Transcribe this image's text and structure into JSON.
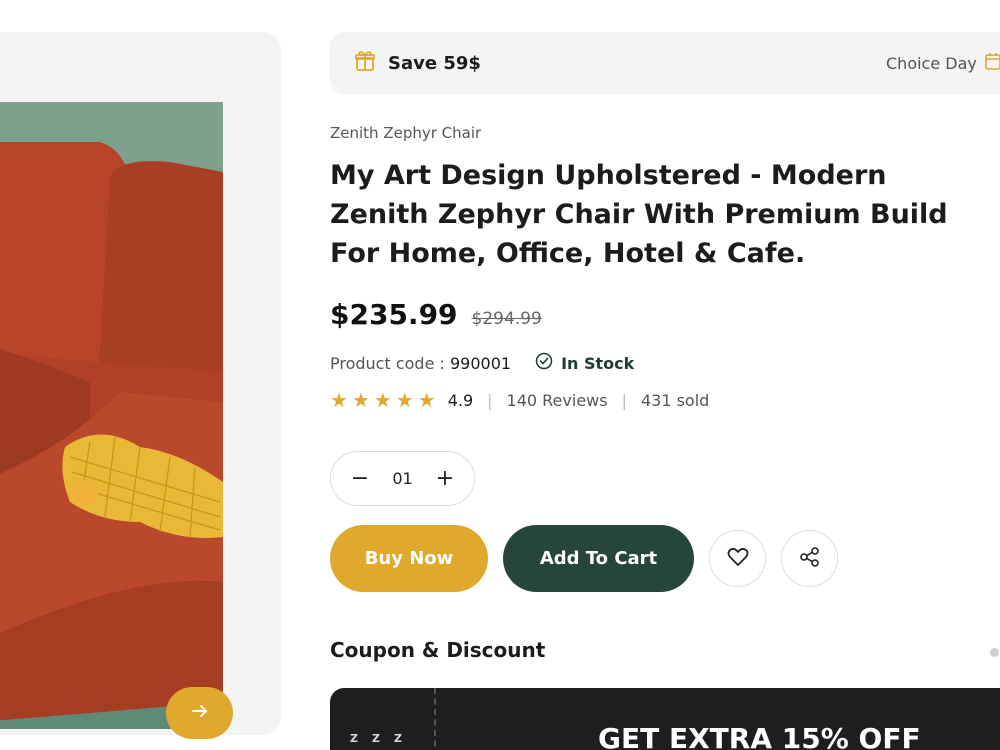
{
  "promo": {
    "save_text": "Save 59$",
    "choice_text": "Choice Day",
    "gift_icon": "gift-icon",
    "calendar_icon": "calendar-icon"
  },
  "product": {
    "brand": "Zenith Zephyr Chair",
    "title": "My Art Design Upholstered - Modern Zenith Zephyr Chair With Premium Build For Home, Office, Hotel & Cafe.",
    "price": "$235.99",
    "old_price": "$294.99",
    "code_label": "Product code :",
    "code_value": "990001",
    "stock": "In Stock",
    "rating": "4.9",
    "reviews": "140 Reviews",
    "sold": "431 sold",
    "stars": 5
  },
  "quantity": {
    "value": "01",
    "minus": "−",
    "plus": "+"
  },
  "actions": {
    "buy_now": "Buy Now",
    "add_to_cart": "Add To Cart"
  },
  "coupon_section": {
    "title": "Coupon & Discount",
    "coupon_heading": "GET EXTRA 15% OFF",
    "side_text": "ZZZ"
  },
  "colors": {
    "accent": "#e0a92e",
    "primary": "#25453d",
    "dark": "#1e1e1e"
  }
}
